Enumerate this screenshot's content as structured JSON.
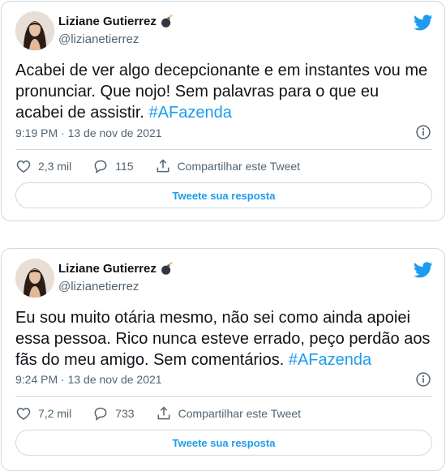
{
  "tweets": [
    {
      "author_name": "Liziane Gutierrez",
      "handle": "@lizianetierrez",
      "text_main": "Acabei de ver algo decepcionante e em instantes vou me pronunciar. Que nojo! Sem palavras para o que eu acabei de assistir. ",
      "hashtag": "#AFazenda",
      "timestamp": "9:19 PM · 13 de nov de 2021",
      "likes": "2,3 mil",
      "replies": "115",
      "share_label": "Compartilhar este Tweet",
      "reply_button_label": "Tweete sua resposta"
    },
    {
      "author_name": "Liziane Gutierrez",
      "handle": "@lizianetierrez",
      "text_main": "Eu sou muito otária mesmo, não sei como ainda apoiei essa pessoa. Rico nunca esteve errado, peço perdão aos fãs do meu amigo. Sem comentários. ",
      "hashtag": "#AFazenda",
      "timestamp": "9:24 PM · 13 de nov de 2021",
      "likes": "7,2 mil",
      "replies": "733",
      "share_label": "Compartilhar este Tweet",
      "reply_button_label": "Tweete sua resposta"
    }
  ],
  "colors": {
    "accent": "#1d9bf0",
    "text": "#0f1419",
    "muted": "#536471",
    "border": "#cfd9de"
  },
  "icons": [
    "bomb-emoji-icon",
    "twitter-bird-icon",
    "info-icon",
    "heart-icon",
    "reply-bubble-icon",
    "share-icon"
  ]
}
